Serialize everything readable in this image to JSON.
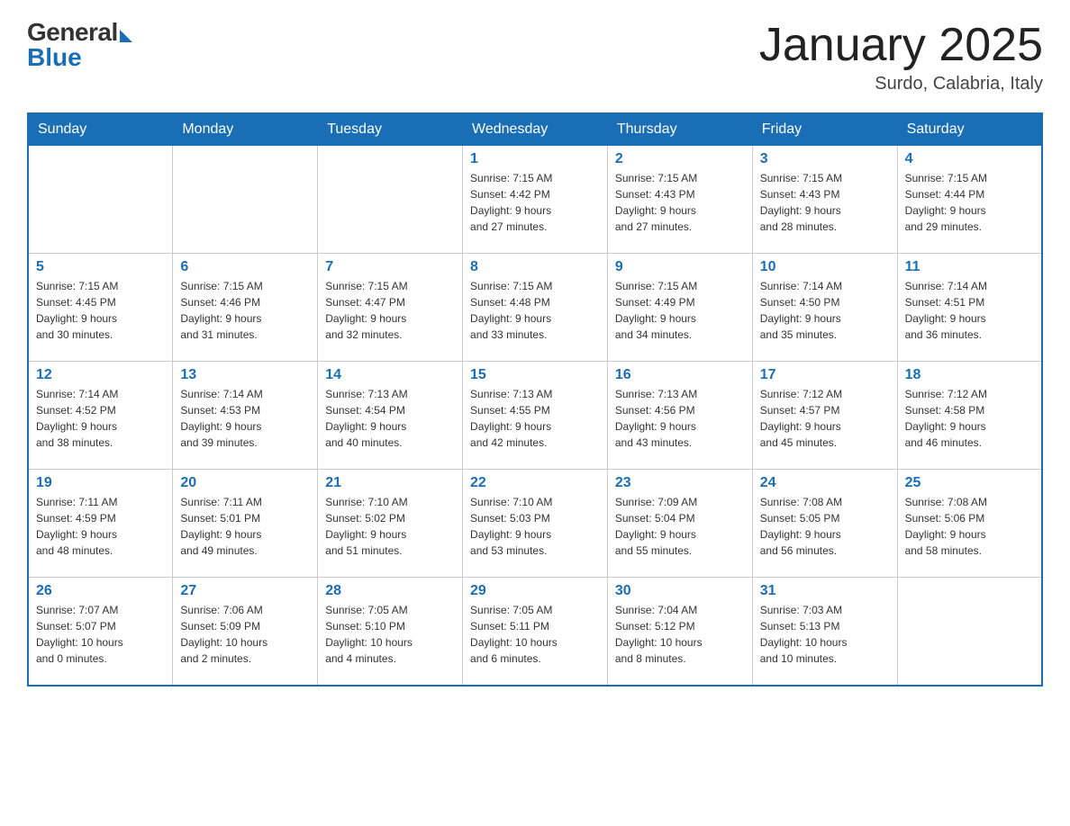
{
  "header": {
    "logo_general": "General",
    "logo_blue": "Blue",
    "title": "January 2025",
    "location": "Surdo, Calabria, Italy"
  },
  "days_of_week": [
    "Sunday",
    "Monday",
    "Tuesday",
    "Wednesday",
    "Thursday",
    "Friday",
    "Saturday"
  ],
  "weeks": [
    [
      {
        "day": "",
        "info": ""
      },
      {
        "day": "",
        "info": ""
      },
      {
        "day": "",
        "info": ""
      },
      {
        "day": "1",
        "info": "Sunrise: 7:15 AM\nSunset: 4:42 PM\nDaylight: 9 hours\nand 27 minutes."
      },
      {
        "day": "2",
        "info": "Sunrise: 7:15 AM\nSunset: 4:43 PM\nDaylight: 9 hours\nand 27 minutes."
      },
      {
        "day": "3",
        "info": "Sunrise: 7:15 AM\nSunset: 4:43 PM\nDaylight: 9 hours\nand 28 minutes."
      },
      {
        "day": "4",
        "info": "Sunrise: 7:15 AM\nSunset: 4:44 PM\nDaylight: 9 hours\nand 29 minutes."
      }
    ],
    [
      {
        "day": "5",
        "info": "Sunrise: 7:15 AM\nSunset: 4:45 PM\nDaylight: 9 hours\nand 30 minutes."
      },
      {
        "day": "6",
        "info": "Sunrise: 7:15 AM\nSunset: 4:46 PM\nDaylight: 9 hours\nand 31 minutes."
      },
      {
        "day": "7",
        "info": "Sunrise: 7:15 AM\nSunset: 4:47 PM\nDaylight: 9 hours\nand 32 minutes."
      },
      {
        "day": "8",
        "info": "Sunrise: 7:15 AM\nSunset: 4:48 PM\nDaylight: 9 hours\nand 33 minutes."
      },
      {
        "day": "9",
        "info": "Sunrise: 7:15 AM\nSunset: 4:49 PM\nDaylight: 9 hours\nand 34 minutes."
      },
      {
        "day": "10",
        "info": "Sunrise: 7:14 AM\nSunset: 4:50 PM\nDaylight: 9 hours\nand 35 minutes."
      },
      {
        "day": "11",
        "info": "Sunrise: 7:14 AM\nSunset: 4:51 PM\nDaylight: 9 hours\nand 36 minutes."
      }
    ],
    [
      {
        "day": "12",
        "info": "Sunrise: 7:14 AM\nSunset: 4:52 PM\nDaylight: 9 hours\nand 38 minutes."
      },
      {
        "day": "13",
        "info": "Sunrise: 7:14 AM\nSunset: 4:53 PM\nDaylight: 9 hours\nand 39 minutes."
      },
      {
        "day": "14",
        "info": "Sunrise: 7:13 AM\nSunset: 4:54 PM\nDaylight: 9 hours\nand 40 minutes."
      },
      {
        "day": "15",
        "info": "Sunrise: 7:13 AM\nSunset: 4:55 PM\nDaylight: 9 hours\nand 42 minutes."
      },
      {
        "day": "16",
        "info": "Sunrise: 7:13 AM\nSunset: 4:56 PM\nDaylight: 9 hours\nand 43 minutes."
      },
      {
        "day": "17",
        "info": "Sunrise: 7:12 AM\nSunset: 4:57 PM\nDaylight: 9 hours\nand 45 minutes."
      },
      {
        "day": "18",
        "info": "Sunrise: 7:12 AM\nSunset: 4:58 PM\nDaylight: 9 hours\nand 46 minutes."
      }
    ],
    [
      {
        "day": "19",
        "info": "Sunrise: 7:11 AM\nSunset: 4:59 PM\nDaylight: 9 hours\nand 48 minutes."
      },
      {
        "day": "20",
        "info": "Sunrise: 7:11 AM\nSunset: 5:01 PM\nDaylight: 9 hours\nand 49 minutes."
      },
      {
        "day": "21",
        "info": "Sunrise: 7:10 AM\nSunset: 5:02 PM\nDaylight: 9 hours\nand 51 minutes."
      },
      {
        "day": "22",
        "info": "Sunrise: 7:10 AM\nSunset: 5:03 PM\nDaylight: 9 hours\nand 53 minutes."
      },
      {
        "day": "23",
        "info": "Sunrise: 7:09 AM\nSunset: 5:04 PM\nDaylight: 9 hours\nand 55 minutes."
      },
      {
        "day": "24",
        "info": "Sunrise: 7:08 AM\nSunset: 5:05 PM\nDaylight: 9 hours\nand 56 minutes."
      },
      {
        "day": "25",
        "info": "Sunrise: 7:08 AM\nSunset: 5:06 PM\nDaylight: 9 hours\nand 58 minutes."
      }
    ],
    [
      {
        "day": "26",
        "info": "Sunrise: 7:07 AM\nSunset: 5:07 PM\nDaylight: 10 hours\nand 0 minutes."
      },
      {
        "day": "27",
        "info": "Sunrise: 7:06 AM\nSunset: 5:09 PM\nDaylight: 10 hours\nand 2 minutes."
      },
      {
        "day": "28",
        "info": "Sunrise: 7:05 AM\nSunset: 5:10 PM\nDaylight: 10 hours\nand 4 minutes."
      },
      {
        "day": "29",
        "info": "Sunrise: 7:05 AM\nSunset: 5:11 PM\nDaylight: 10 hours\nand 6 minutes."
      },
      {
        "day": "30",
        "info": "Sunrise: 7:04 AM\nSunset: 5:12 PM\nDaylight: 10 hours\nand 8 minutes."
      },
      {
        "day": "31",
        "info": "Sunrise: 7:03 AM\nSunset: 5:13 PM\nDaylight: 10 hours\nand 10 minutes."
      },
      {
        "day": "",
        "info": ""
      }
    ]
  ]
}
